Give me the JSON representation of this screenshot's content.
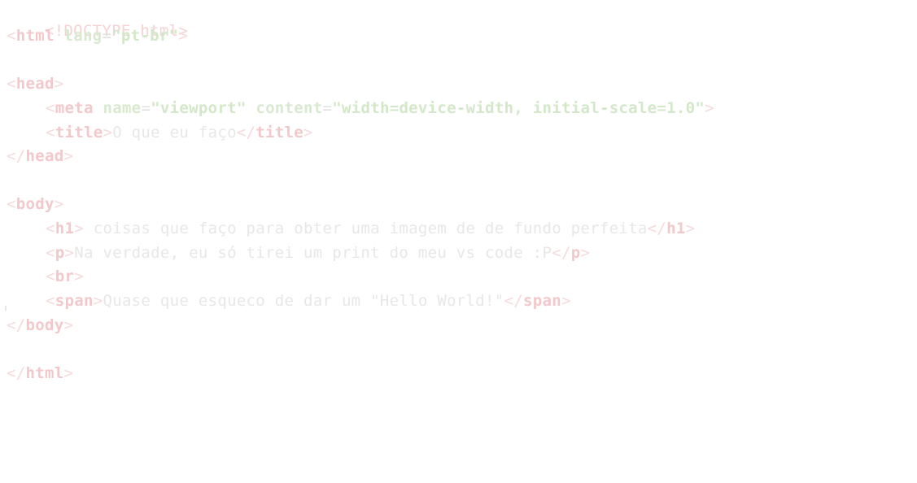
{
  "code": {
    "doctype": "<!DOCTYPE html>",
    "html_open_tag": "html",
    "html_lang_attr": "lang",
    "html_lang_value": "\"pt-br\"",
    "head_tag": "head",
    "meta_tag": "meta",
    "meta_name_attr": "name",
    "meta_name_value": "\"viewport\"",
    "meta_content_attr": "content",
    "meta_content_value": "\"width=device-width, initial-scale=1.0\"",
    "title_tag": "title",
    "title_text": "O que eu faço",
    "body_tag": "body",
    "h1_tag": "h1",
    "h1_text": " coisas que faço para obter uma imagem de de fundo perfeita",
    "p_tag": "p",
    "p_text": "Na verdade, eu só tirei um print do meu vs code :P",
    "br_tag": "br",
    "span_tag": "span",
    "span_text": "Quase que esqueco de dar um \"Hello World!\"",
    "html_close_tag": "html"
  },
  "colors": {
    "tag": "#f2c8cb",
    "attribute": "#d9e9cf",
    "string": "#d3e8c9",
    "text": "#e7e7e7",
    "background": "#ffffff"
  }
}
